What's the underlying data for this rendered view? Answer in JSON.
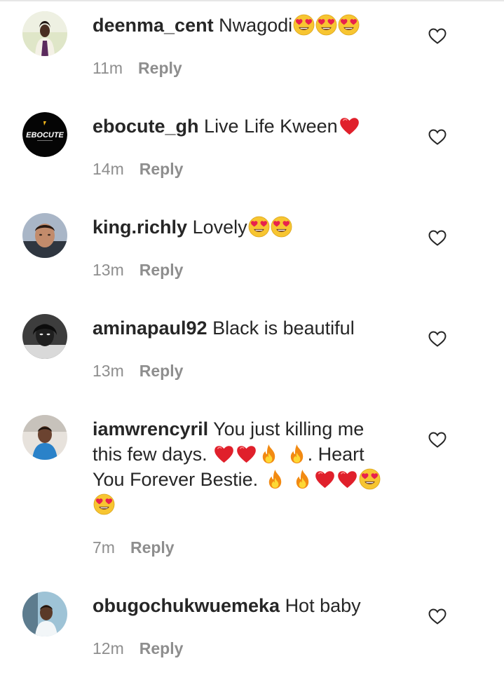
{
  "colors": {
    "text": "#262626",
    "muted": "#8e8e8e",
    "heart_red": "#e0202b",
    "fire_orange": "#f28a12",
    "emoji_yellow": "#f7c531"
  },
  "comments": [
    {
      "username": "deenma_cent",
      "text": "Nwagodi",
      "emojis_after": [
        "heart-eyes",
        "heart-eyes",
        "heart-eyes"
      ],
      "time": "11m",
      "reply": "Reply"
    },
    {
      "username": "ebocute_gh",
      "text": "Live Life Kween",
      "emojis_after": [
        "red-heart"
      ],
      "time": "14m",
      "reply": "Reply",
      "avatar_logo": "EBOCUTE"
    },
    {
      "username": "king.richly",
      "text": "Lovely",
      "emojis_after": [
        "heart-eyes",
        "heart-eyes"
      ],
      "time": "13m",
      "reply": "Reply"
    },
    {
      "username": "aminapaul92",
      "text": "Black is beautiful",
      "emojis_after": [],
      "time": "13m",
      "reply": "Reply"
    },
    {
      "username": "iamwrencyril",
      "text_1": "You just killing me this few days.",
      "text_2": ". Heart You Forever Bestie.",
      "time": "7m",
      "reply": "Reply"
    },
    {
      "username": "obugochukwuemeka",
      "text": "Hot baby",
      "emojis_after": [],
      "time": "12m",
      "reply": "Reply"
    }
  ]
}
